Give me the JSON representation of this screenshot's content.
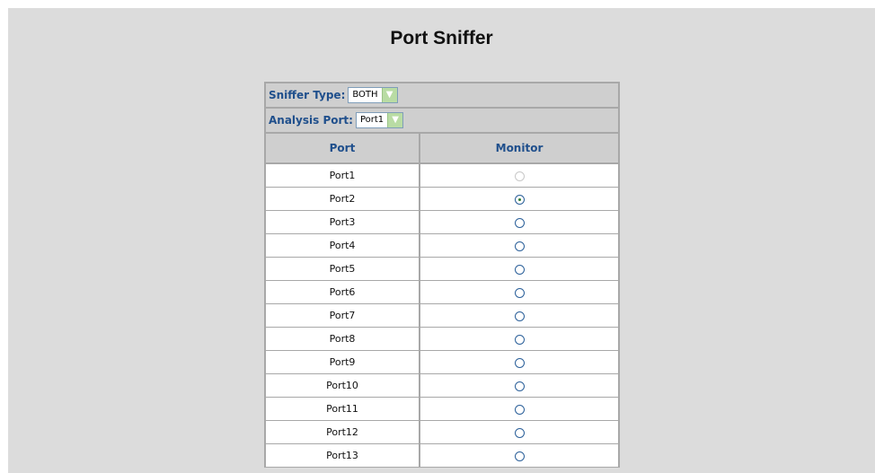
{
  "page": {
    "title": "Port Sniffer"
  },
  "controls": {
    "sniffer_type": {
      "label": "Sniffer Type:",
      "value": "BOTH"
    },
    "analysis_port": {
      "label": "Analysis Port:",
      "value": "Port1"
    }
  },
  "table": {
    "headers": [
      "Port",
      "Monitor"
    ],
    "rows": [
      {
        "port": "Port1",
        "monitor": "disabled"
      },
      {
        "port": "Port2",
        "monitor": "checked"
      },
      {
        "port": "Port3",
        "monitor": "unchecked"
      },
      {
        "port": "Port4",
        "monitor": "unchecked"
      },
      {
        "port": "Port5",
        "monitor": "unchecked"
      },
      {
        "port": "Port6",
        "monitor": "unchecked"
      },
      {
        "port": "Port7",
        "monitor": "unchecked"
      },
      {
        "port": "Port8",
        "monitor": "unchecked"
      },
      {
        "port": "Port9",
        "monitor": "unchecked"
      },
      {
        "port": "Port10",
        "monitor": "unchecked"
      },
      {
        "port": "Port11",
        "monitor": "unchecked"
      },
      {
        "port": "Port12",
        "monitor": "unchecked"
      },
      {
        "port": "Port13",
        "monitor": "unchecked"
      }
    ]
  },
  "icons": {
    "dropdown": "chevron-down-icon"
  },
  "colors": {
    "background": "#dcdcdc",
    "header_text": "#1f4f8c",
    "cell_border": "#a8a8a8",
    "combo_arrow": "#b9dca4",
    "radio_border": "#2a5f99",
    "radio_dot": "#2f7d2f"
  }
}
